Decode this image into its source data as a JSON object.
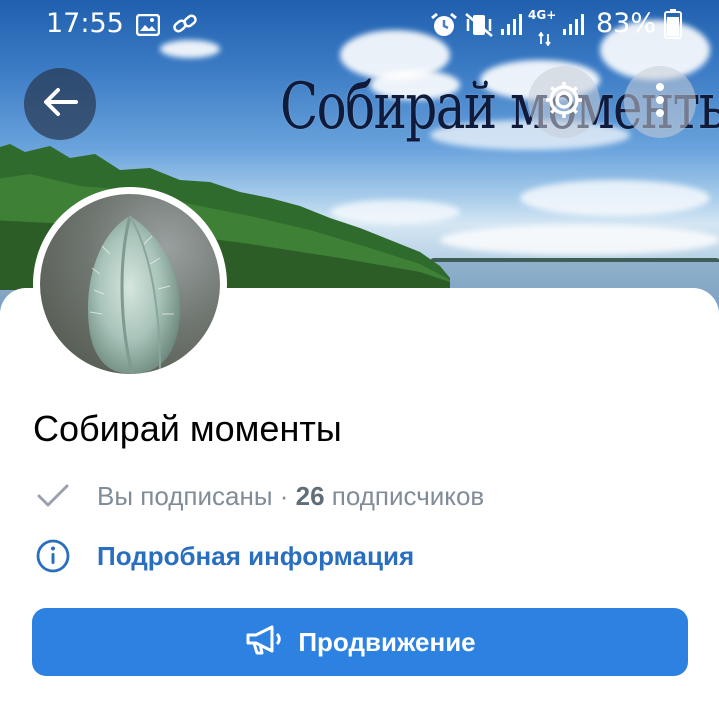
{
  "status_bar": {
    "time": "17:55",
    "network": "4G+",
    "battery": "83%",
    "icons": [
      "image-icon",
      "link-icon",
      "alarm-icon",
      "vibrate-icon",
      "signal-icon",
      "signal-icon",
      "battery-icon"
    ]
  },
  "cover": {
    "title": "Собирай моменты"
  },
  "header": {
    "back_icon": "back-arrow-icon",
    "settings_icon": "gear-icon",
    "more_icon": "more-vertical-icon"
  },
  "profile": {
    "name": "Собирай моменты",
    "subscription_status": "Вы подписаны",
    "separator": " · ",
    "subscribers_count": "26",
    "subscribers_label": " подписчиков",
    "info_link": "Подробная информация",
    "promo_button": "Продвижение"
  },
  "colors": {
    "accent": "#2d81e0",
    "link": "#2a6fbf",
    "secondary_text": "#818c99"
  }
}
